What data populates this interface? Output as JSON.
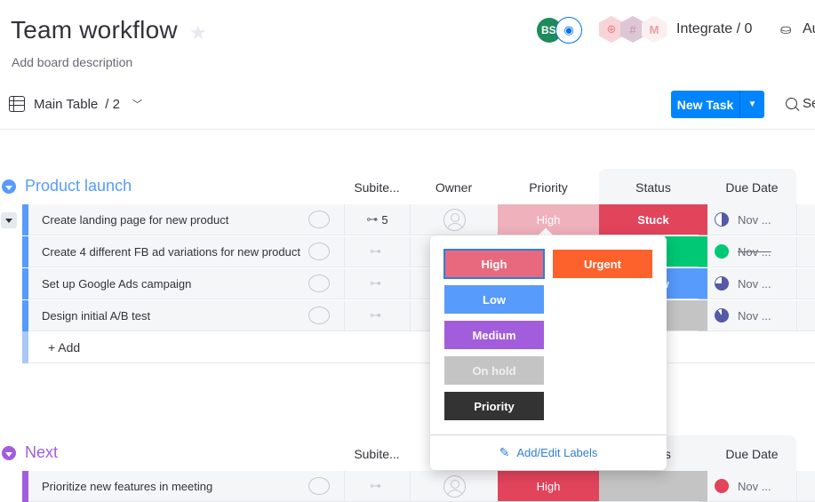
{
  "header": {
    "title": "Team workflow",
    "description": "Add board description",
    "view_name": "Main Table",
    "view_count": "/ 2",
    "avatar_initials": "BS",
    "integrate_label": "Integrate / 0",
    "automate_label": "Au",
    "new_task_label": "New Task",
    "search_label": "Se"
  },
  "columns": {
    "subitems": "Subite...",
    "owner": "Owner",
    "priority": "Priority",
    "status": "Status",
    "due_date": "Due Date"
  },
  "groups": [
    {
      "title": "Product launch",
      "color": "#579bfc",
      "rows": [
        {
          "name": "Create landing page for new product",
          "subitems": "5",
          "priority": "High",
          "priority_color": "#efb1bc",
          "status": "Stuck",
          "status_color": "#e2445c",
          "due": "Nov ...",
          "due_state": "half",
          "due_strike": false
        },
        {
          "name": "Create 4 different FB ad variations for new product",
          "subitems": "",
          "priority": "",
          "priority_color": "#ffffff",
          "status": "",
          "status_color": "#00c875",
          "due": "Nov ...",
          "due_state": "done",
          "due_strike": true
        },
        {
          "name": "Set up Google Ads campaign",
          "subitems": "",
          "priority": "",
          "priority_color": "#ffffff",
          "status": "eview",
          "status_color": "#579bfc",
          "due": "Nov ...",
          "due_state": "three-quarter",
          "due_strike": false
        },
        {
          "name": "Design initial A/B test",
          "subitems": "",
          "priority": "",
          "priority_color": "#ffffff",
          "status": "",
          "status_color": "#c4c4c4",
          "due": "Nov ...",
          "due_state": "most",
          "due_strike": false
        }
      ],
      "add_label": "+ Add"
    },
    {
      "title": "Next",
      "color": "#a25ddc",
      "rows": [
        {
          "name": "Prioritize new features in meeting",
          "subitems": "",
          "priority": "High",
          "priority_color": "#e2445c",
          "status": "",
          "status_color": "#c4c4c4",
          "due": "Nov ...",
          "due_state": "overdue",
          "due_strike": false
        }
      ]
    }
  ],
  "priority_dropdown": {
    "labels": [
      {
        "label": "High",
        "color": "#e8697d",
        "selected": true
      },
      {
        "label": "Urgent",
        "color": "#fd612c",
        "selected": false
      },
      {
        "label": "Low",
        "color": "#579bfc",
        "selected": false
      },
      {
        "label": "Medium",
        "color": "#a25ddc",
        "selected": false
      },
      {
        "label": "On hold",
        "color": "#c4c4c4",
        "selected": false
      },
      {
        "label": "Priority",
        "color": "#333333",
        "selected": false
      }
    ],
    "footer_label": "Add/Edit Labels"
  },
  "colors": {
    "accent": "#0085ff",
    "link": "#2f7ed8",
    "due_icon": "#5559a7",
    "done_green": "#00c875",
    "overdue_red": "#e2445c"
  }
}
